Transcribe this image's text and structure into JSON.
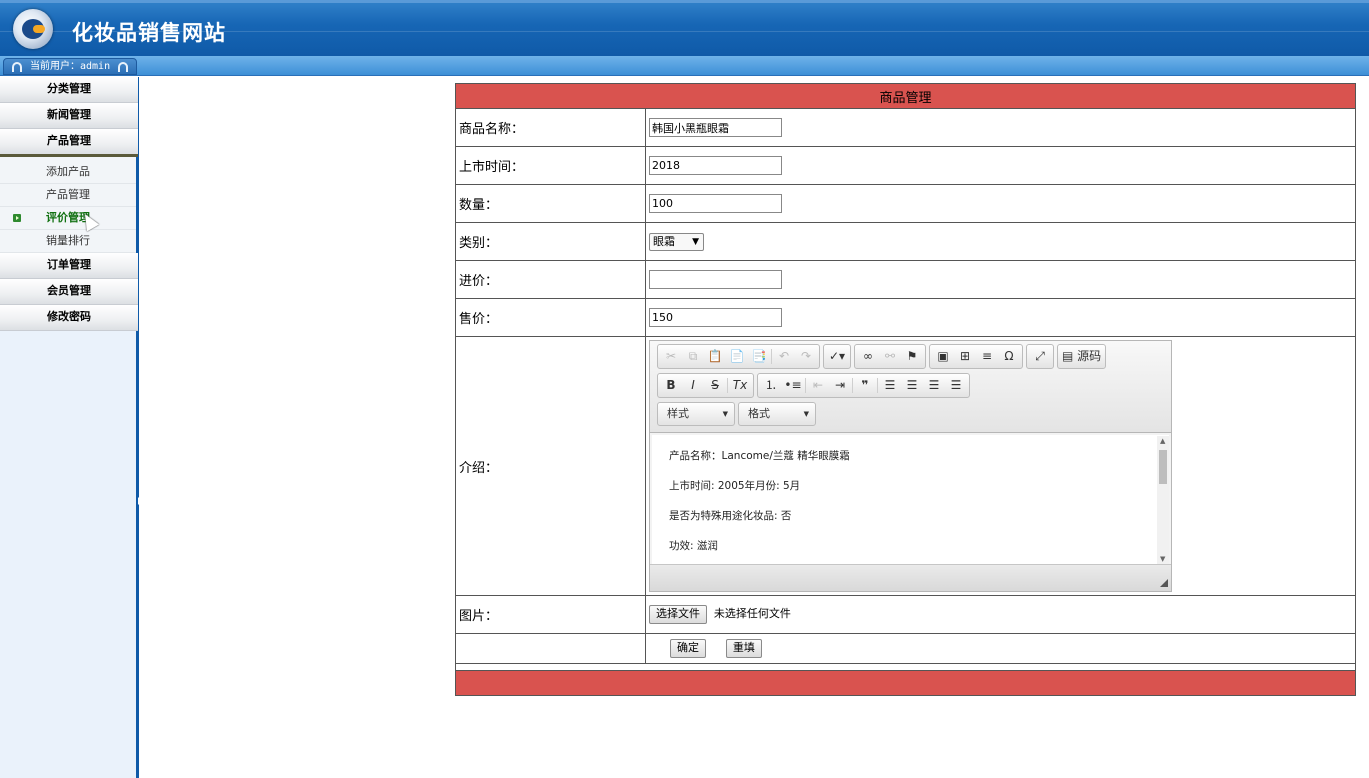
{
  "header": {
    "site_title": "化妆品销售网站",
    "current_user_label": "当前用户：admin"
  },
  "sidebar": {
    "menus": [
      {
        "label": "分类管理"
      },
      {
        "label": "新闻管理"
      },
      {
        "label": "产品管理",
        "expanded": true,
        "items": [
          {
            "label": "添加产品"
          },
          {
            "label": "产品管理"
          },
          {
            "label": "评价管理",
            "active": true
          },
          {
            "label": "销量排行"
          }
        ]
      },
      {
        "label": "订单管理"
      },
      {
        "label": "会员管理"
      },
      {
        "label": "修改密码"
      }
    ]
  },
  "form": {
    "title": "商品管理",
    "name_label": "商品名称：",
    "name_value": "韩国小黑瓶眼霜",
    "date_label": "上市时间：",
    "date_value": "2018",
    "qty_label": "数量：",
    "qty_value": "100",
    "category_label": "类别：",
    "category_value": "眼霜",
    "cost_label": "进价：",
    "cost_value": "",
    "price_label": "售价：",
    "price_value": "150",
    "intro_label": "介绍：",
    "image_label": "图片：",
    "file_button": "选择文件",
    "file_status": "未选择任何文件",
    "submit_button": "确定",
    "reset_button": "重填"
  },
  "editor": {
    "source_button": "源码",
    "style_combo": "样式",
    "format_combo": "格式",
    "content": [
      "产品名称：Lancome/兰蔻 精华眼膜霜",
      "上市时间: 2005年月份: 5月",
      "是否为特殊用途化妆品: 否",
      "功效: 滋润"
    ]
  },
  "colors": {
    "header_blue": "#1766b5",
    "table_title_red": "#d9534f",
    "sidebar_bg": "#eaf2fb",
    "active_green": "#107010"
  }
}
